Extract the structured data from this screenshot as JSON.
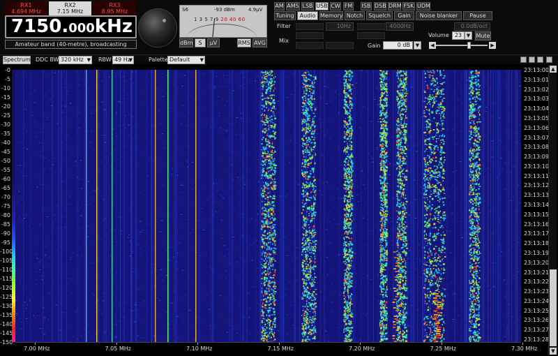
{
  "receivers": [
    {
      "name": "RX1",
      "freq": "4.694 MHz",
      "state": "inactive"
    },
    {
      "name": "RX2",
      "freq": "7.15 MHz",
      "state": "active"
    },
    {
      "name": "RX3",
      "freq": "8.95 MHz",
      "state": "inactive"
    }
  ],
  "frequency": {
    "main": "7150.",
    "fraction": "000",
    "unit": "kHz"
  },
  "band_info": "Amateur band (40-metre), broadcasting",
  "smeter": {
    "s_label": "S6",
    "dbm": "-93 dBm",
    "uv": "4.9µV",
    "scale_black": "1 3 5 7 9",
    "scale_red": "20 40 60",
    "buttons": {
      "dbm": "dBm",
      "s": "S",
      "uv": "µV",
      "rms": "RMS",
      "avg": "AVG"
    }
  },
  "modes": [
    "AM",
    "AMS",
    "LSB",
    "USB",
    "CW",
    "FM",
    "ISB",
    "DSB",
    "DRM",
    "FSK",
    "UDM"
  ],
  "active_mode": "USB",
  "tabs": [
    "Tuning",
    "Audio",
    "Memory",
    "Notch",
    "Squelch",
    "Gain",
    "Noise blanker",
    "Pause"
  ],
  "active_tab": "Audio",
  "audio": {
    "filter_label": "Filter",
    "filter_value": "10Hz",
    "filter_value2": "4000Hz",
    "slope_value": "0.0dB/oct",
    "mix_label": "Mix",
    "gain_label": "Gain",
    "gain_value": "0 dB",
    "volume_label": "Volume",
    "volume_value": "23",
    "mute_label": "Mute",
    "volume_level_percent": 65
  },
  "spectrum_toolbar": {
    "spectrum_label": "Spectrum",
    "ddc_bw_label": "DDC BW",
    "ddc_bw_value": "320 kHz",
    "rbw_label": "RBW",
    "rbw_value": "49 Hz",
    "palette_label": "Palette",
    "palette_value": "Default"
  },
  "db_scale": [
    "-0",
    "-5",
    "-10",
    "-15",
    "-20",
    "-25",
    "-30",
    "-35",
    "-40",
    "-45",
    "-50",
    "-55",
    "-60",
    "-65",
    "-70",
    "-75",
    "-80",
    "-85",
    "-90",
    "-95",
    "-100",
    "-105",
    "-110",
    "-115",
    "-120",
    "-125",
    "-130",
    "-135",
    "-140",
    "-145",
    "-150"
  ],
  "time_scale": [
    "23:13:00",
    "23:13:01",
    "23:13:02",
    "23:13:03",
    "23:13:04",
    "23:13:05",
    "23:13:06",
    "23:13:07",
    "23:13:08",
    "23:13:09",
    "23:13:10",
    "23:13:11",
    "23:13:12",
    "23:13:13",
    "23:13:14",
    "23:13:15",
    "23:13:16",
    "23:13:17",
    "23:13:18",
    "23:13:19",
    "23:13:20",
    "23:13:21",
    "23:13:22",
    "23:13:23",
    "23:13:24",
    "23:13:25",
    "23:13:26",
    "23:13:27",
    "23:13:28"
  ],
  "freq_axis": [
    "7.00 MHz",
    "7.05 MHz",
    "7.10 MHz",
    "7.15 MHz",
    "7.20 MHz",
    "7.25 MHz",
    "7.30 MHz"
  ],
  "colors": {
    "background": "#000000",
    "waterfall_base": "#14147a",
    "accent_red": "#ff4a4a"
  },
  "icons": {
    "window_min": "minimize-icon",
    "window_save": "save-icon",
    "window_settings": "settings-icon",
    "window_close": "close-icon"
  }
}
